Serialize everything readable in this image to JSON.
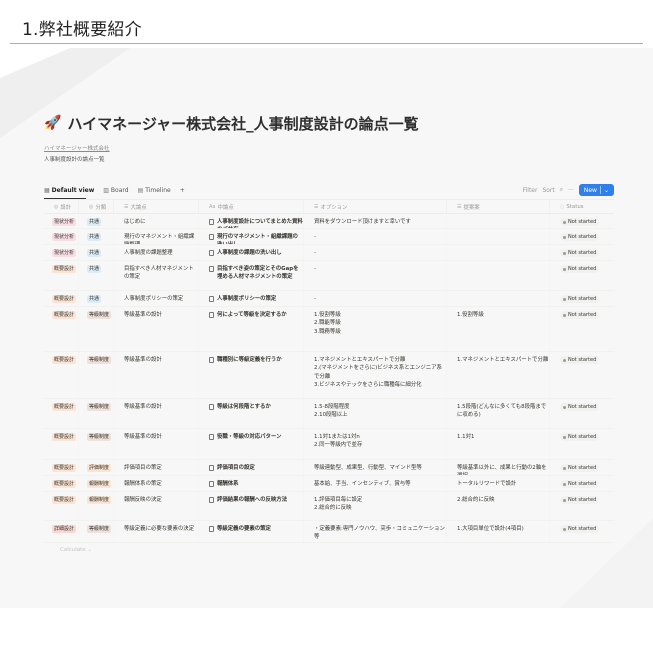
{
  "slide": {
    "title": "1.弊社概要紹介"
  },
  "page": {
    "icon": "rocket-icon",
    "title": "ハイマネージャー株式会社_人事制度設計の論点一覧",
    "breadcrumb": "ハイマネージャー株式会社",
    "subtitle": "人事制度設計の論点一覧"
  },
  "toolbar": {
    "views": [
      {
        "label": "Default view",
        "icon": "table-icon"
      },
      {
        "label": "Board",
        "icon": "board-icon"
      },
      {
        "label": "Timeline",
        "icon": "timeline-icon"
      }
    ],
    "add_view": "+",
    "filter": "Filter",
    "sort": "Sort",
    "search_icon": "search-icon",
    "more": "···",
    "new_label": "New"
  },
  "columns": [
    {
      "label": "設計",
      "icon": "status-icon"
    },
    {
      "label": "分類",
      "icon": "status-icon"
    },
    {
      "label": "大論点",
      "icon": "text-icon"
    },
    {
      "label": "中論点",
      "icon": "title-icon"
    },
    {
      "label": "オプション",
      "icon": "text-icon"
    },
    {
      "label": "提案案",
      "icon": "text-icon"
    },
    {
      "label": "Status",
      "icon": "status-icon"
    }
  ],
  "colors": {
    "tag_pink": "#f9dde5",
    "tag_orange": "#fbe4d4",
    "tag_blue": "#dbecf7",
    "tag_brown": "#eee0da",
    "tag_red": "#f9d8d3",
    "accent": "#2f80ed",
    "rule": "#e9a33c"
  },
  "rows": [
    {
      "design": "現状分析",
      "design_color": "#f9dde5",
      "category": "共通",
      "category_color": "#dbecf7",
      "major": "はじめに",
      "middle": "人事制度設計についてまとめた資料のご共有",
      "options": "資料をダウンロード頂けますと幸いです",
      "proposal": "",
      "status": "Not started"
    },
    {
      "design": "現状分析",
      "design_color": "#f9dde5",
      "category": "共通",
      "category_color": "#dbecf7",
      "major": "現行のマネジメント・組織課題整理",
      "middle": "現行のマネジメント・組織課題の洗い出し",
      "options": "-",
      "proposal": "",
      "status": "Not started"
    },
    {
      "design": "現状分析",
      "design_color": "#f9dde5",
      "category": "共通",
      "category_color": "#dbecf7",
      "major": "人事制度の課題整理",
      "middle": "人事制度の課題の洗い出し",
      "options": "-",
      "proposal": "",
      "status": "Not started"
    },
    {
      "design": "概要設計",
      "design_color": "#fbe4d4",
      "category": "共通",
      "category_color": "#dbecf7",
      "major": "目指すべき人材マネジメントの策定",
      "middle": "目指すべき姿の策定とそのGapを埋める人材マネジメントの策定",
      "options": "-",
      "proposal": "",
      "status": "Not started"
    },
    {
      "design": "概要設計",
      "design_color": "#fbe4d4",
      "category": "共通",
      "category_color": "#dbecf7",
      "major": "人事制度ポリシーの策定",
      "middle": "人事制度ポリシーの策定",
      "options": "-",
      "proposal": "",
      "status": "Not started"
    },
    {
      "design": "概要設計",
      "design_color": "#fbe4d4",
      "category": "等級制度",
      "category_color": "#eee0da",
      "major": "等級基準の設計",
      "middle": "何によって等級を決定するか",
      "options": "1.役割等級\n2.職能等級\n3.職務等級",
      "proposal": "1.役割等級",
      "status": "Not started"
    },
    {
      "design": "概要設計",
      "design_color": "#fbe4d4",
      "category": "等級制度",
      "category_color": "#eee0da",
      "major": "等級基準の設計",
      "middle": "職種別に等級定義を行うか",
      "options": "1.マネジメントとエキスパートで分離\n2.(マネジメントをさらに)ビジネス系とエンジニア系で分離\n3.ビジネスやテックをさらに職種毎に細分化",
      "proposal": "1.マネジメントとエキスパートで分離",
      "status": "Not started"
    },
    {
      "design": "概要設計",
      "design_color": "#fbe4d4",
      "category": "等級制度",
      "category_color": "#eee0da",
      "major": "等級基準の設計",
      "middle": "等級は何段階とするか",
      "options": "1.5-8段階程度\n2.10段階以上",
      "proposal": "1.5段階(どんなに多くても8段階までに収める)",
      "status": "Not started"
    },
    {
      "design": "概要設計",
      "design_color": "#fbe4d4",
      "category": "等級制度",
      "category_color": "#eee0da",
      "major": "等級基準の設計",
      "middle": "役職・等級の対応パターン",
      "options": "1.1対1または1対n\n2.同一等級内で並存",
      "proposal": "1.1対1",
      "status": "Not started"
    },
    {
      "design": "概要設計",
      "design_color": "#fbe4d4",
      "category": "評価制度",
      "category_color": "#fbe4d4",
      "major": "評価項目の策定",
      "middle": "評価項目の設定",
      "options": "等級連動型、成果型、行動型、マインド型等",
      "proposal": "等級基準以外に、成果と行動の2軸を選択",
      "status": "Not started"
    },
    {
      "design": "概要設計",
      "design_color": "#fbe4d4",
      "category": "報酬制度",
      "category_color": "#fbe4d4",
      "major": "報酬体系の策定",
      "middle": "報酬体系",
      "options": "基本給、手当、インセンティブ、賞与等",
      "proposal": "トータルリワードで設計",
      "status": "Not started"
    },
    {
      "design": "概要設計",
      "design_color": "#fbe4d4",
      "category": "報酬制度",
      "category_color": "#fbe4d4",
      "major": "報酬反映の決定",
      "middle": "評価結果の報酬への反映方法",
      "options": "1.評価項目毎に設定\n2.総合的に反映",
      "proposal": "2.総合的に反映",
      "status": "Not started"
    },
    {
      "design": "詳細設計",
      "design_color": "#f9d8d3",
      "category": "等級制度",
      "category_color": "#eee0da",
      "major": "等級定義に必要な要素の決定",
      "middle": "等級定義の要素の策定",
      "options": "・定義要素:専門ノウハウ、突歩・コミュニケーション等",
      "proposal": "1.大項目単位で設計(4項目)",
      "status": "Not started"
    }
  ],
  "footer": {
    "calculate": "Calculate ⌄"
  }
}
